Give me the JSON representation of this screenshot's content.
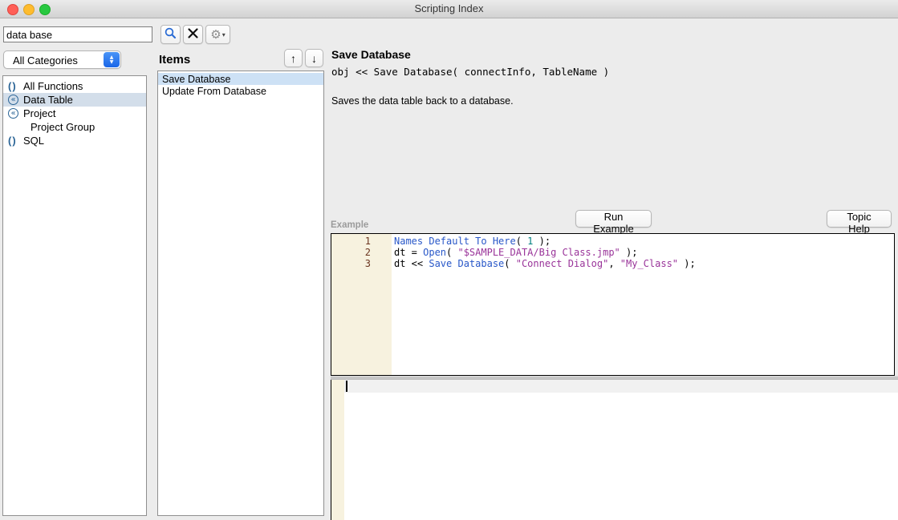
{
  "window": {
    "title": "Scripting Index"
  },
  "search": {
    "value": "data base",
    "search_icon": "magnifier",
    "clear_icon": "x-mark",
    "settings_icon": "gear-with-dropdown"
  },
  "category_dropdown": {
    "value": "All Categories"
  },
  "categories": [
    {
      "label": "All Functions",
      "icon": "parentheses",
      "indent": 0,
      "selected": false
    },
    {
      "label": "Data Table",
      "icon": "send-message",
      "indent": 0,
      "selected": true
    },
    {
      "label": "Project",
      "icon": "send-message",
      "indent": 0,
      "selected": false
    },
    {
      "label": "Project Group",
      "icon": "none",
      "indent": 1,
      "selected": false
    },
    {
      "label": "SQL",
      "icon": "parentheses",
      "indent": 0,
      "selected": false
    }
  ],
  "items_panel": {
    "title": "Items",
    "items": [
      {
        "label": "Save Database",
        "selected": true
      },
      {
        "label": "Update From Database",
        "selected": false
      }
    ]
  },
  "detail": {
    "title": "Save Database",
    "syntax": "obj << Save Database( connectInfo, TableName )",
    "description": "Saves the data table back to a database.",
    "run_example_label": "Run Example",
    "topic_help_label": "Topic Help",
    "example_label": "Example"
  },
  "example_code": {
    "lines": [
      {
        "num": "1",
        "tokens": [
          {
            "t": "Names Default To Here",
            "c": "fn"
          },
          {
            "t": "( ",
            "c": "pl"
          },
          {
            "t": "1",
            "c": "num"
          },
          {
            "t": " );",
            "c": "pl"
          }
        ]
      },
      {
        "num": "2",
        "tokens": [
          {
            "t": "dt = ",
            "c": "pl"
          },
          {
            "t": "Open",
            "c": "fn"
          },
          {
            "t": "( ",
            "c": "pl"
          },
          {
            "t": "\"$SAMPLE_DATA/Big Class.jmp\"",
            "c": "str"
          },
          {
            "t": " );",
            "c": "pl"
          }
        ]
      },
      {
        "num": "3",
        "tokens": [
          {
            "t": "dt << ",
            "c": "pl"
          },
          {
            "t": "Save Database",
            "c": "fn"
          },
          {
            "t": "( ",
            "c": "pl"
          },
          {
            "t": "\"Connect Dialog\"",
            "c": "str"
          },
          {
            "t": ", ",
            "c": "pl"
          },
          {
            "t": "\"My_Class\"",
            "c": "str"
          },
          {
            "t": " );",
            "c": "pl"
          }
        ]
      }
    ]
  },
  "colors": {
    "function_name": "#2857c8",
    "string_literal": "#993399",
    "number_literal": "#007f7f",
    "line_number": "#6b3520",
    "selection_item": "#cde1f5",
    "selection_category": "#d3deea",
    "dropdown_accent": "#4a95f7",
    "gutter_background": "#f7f2df",
    "traffic_red": "#ff5f57",
    "traffic_yellow": "#febc2e",
    "traffic_green": "#28c840"
  }
}
